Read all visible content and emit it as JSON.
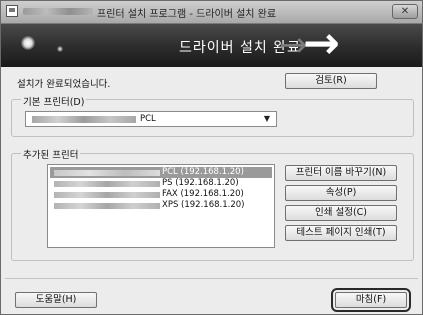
{
  "window": {
    "title": "프린터 설치 프로그램 - 드라이버 설치 완료",
    "close_label": "✕"
  },
  "banner": {
    "heading": "드라이버 설치 완료"
  },
  "main": {
    "status_text": "설치가 완료되었습니다.",
    "review_button": "검토(R)",
    "default_printer": {
      "label": "기본 프린터(D)",
      "selected_suffix": "PCL"
    },
    "added_printers": {
      "label": "추가된 프린터",
      "items": [
        {
          "suffix": "PCL (192.168.1.20)",
          "selected": true
        },
        {
          "suffix": "PS (192.168.1.20)",
          "selected": false
        },
        {
          "suffix": "FAX (192.168.1.20)",
          "selected": false
        },
        {
          "suffix": "XPS (192.168.1.20)",
          "selected": false
        }
      ],
      "buttons": {
        "rename": "프린터 이름 바꾸기(N)",
        "properties": "속성(P)",
        "print_settings": "인쇄 설정(C)",
        "test_page": "테스트 페이지 인쇄(T)"
      }
    }
  },
  "footer": {
    "help_button": "도움말(H)",
    "finish_button": "마침(F)"
  }
}
